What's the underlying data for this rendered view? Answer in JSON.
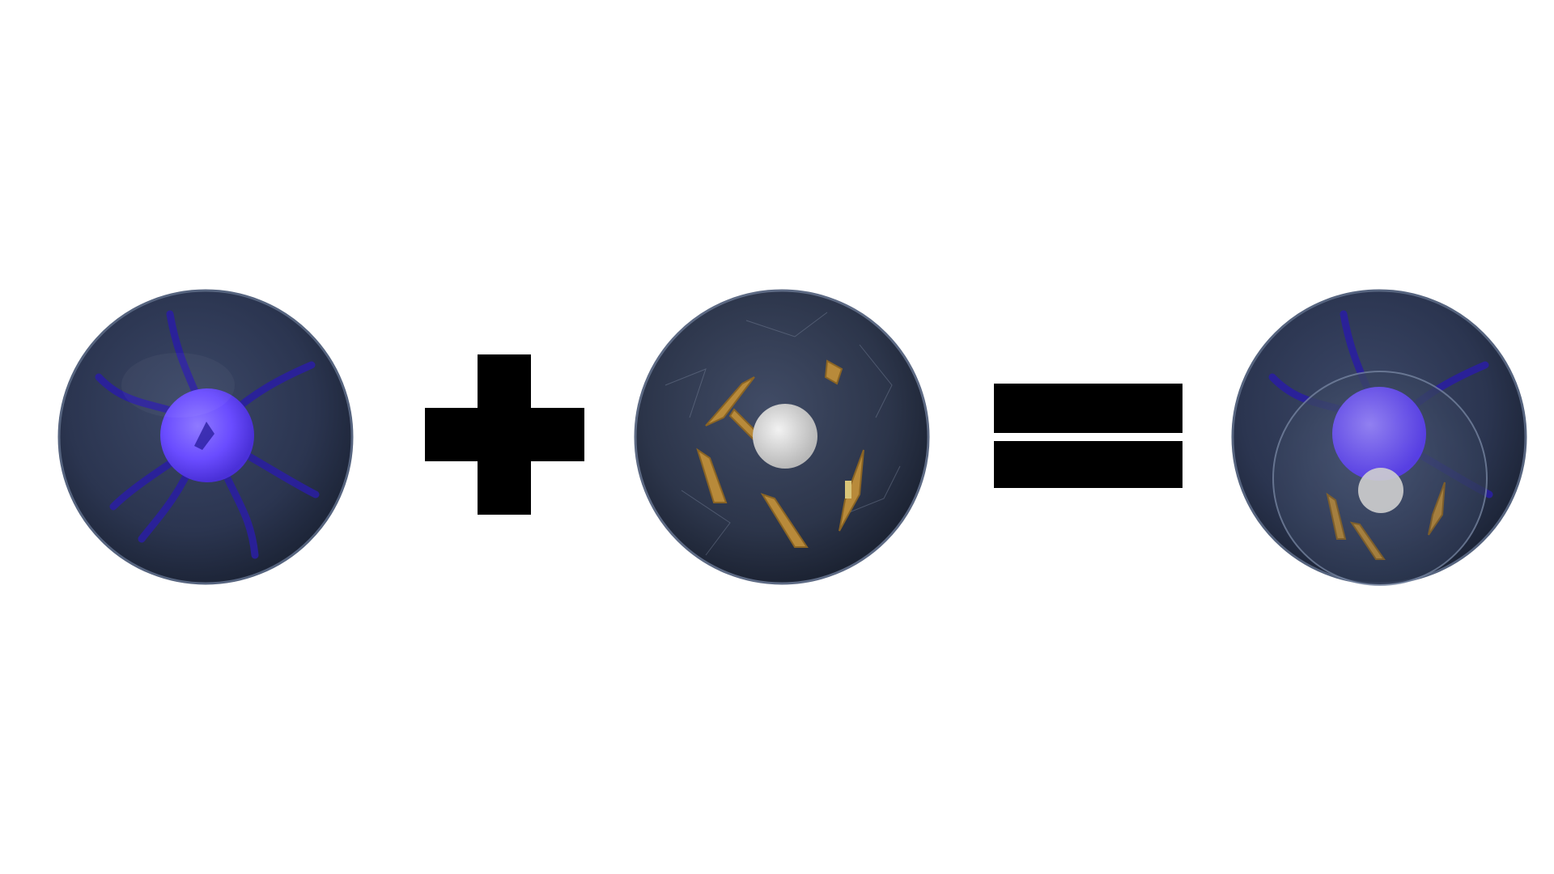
{
  "scene": {
    "background": "#ffffff",
    "colors": {
      "shell": "#2b3550",
      "shell_rim": "#5a6a88",
      "nucleus_blue": "#6a4cff",
      "fiber_blue": "#2a1fa0",
      "crystal_gold": "#b88a3a",
      "core_white": "#d8d8d8",
      "operator": "#000000"
    },
    "items": [
      {
        "kind": "sphere",
        "icon": "blue-nucleus-orb-icon"
      },
      {
        "kind": "operator",
        "icon": "plus-icon"
      },
      {
        "kind": "sphere",
        "icon": "crystal-orb-icon"
      },
      {
        "kind": "operator",
        "icon": "equals-icon"
      },
      {
        "kind": "sphere",
        "icon": "merged-orb-icon"
      }
    ]
  }
}
